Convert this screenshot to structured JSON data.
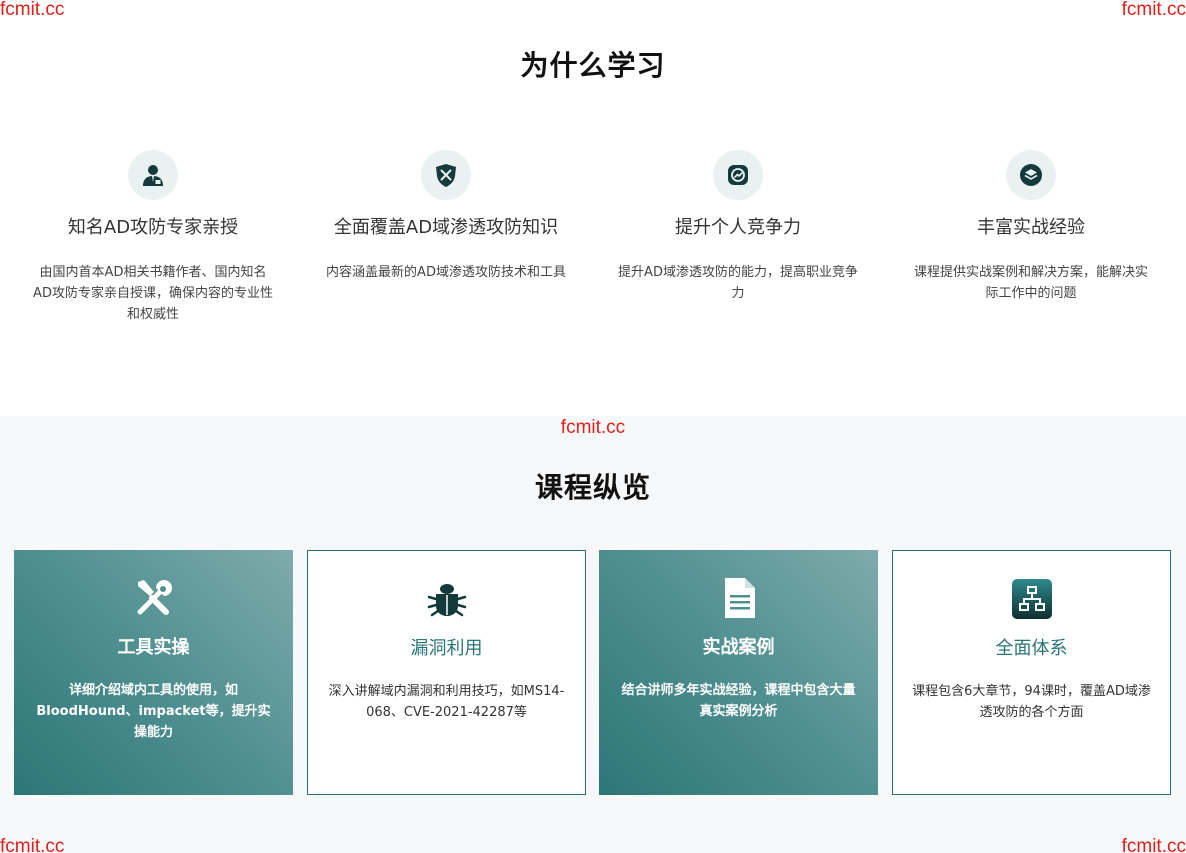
{
  "watermark": {
    "text": "fcmit.cc"
  },
  "why_section": {
    "title": "为什么学习",
    "features": [
      {
        "icon": "expert-icon",
        "title": "知名AD攻防专家亲授",
        "desc": "由国内首本AD相关书籍作者、国内知名AD攻防专家亲自授课，确保内容的专业性和权威性"
      },
      {
        "icon": "shield-sword-icon",
        "title": "全面覆盖AD域渗透攻防知识",
        "desc": "内容涵盖最新的AD域渗透攻防技术和工具"
      },
      {
        "icon": "growth-icon",
        "title": "提升个人竞争力",
        "desc": "提升AD域渗透攻防的能力，提高职业竞争力"
      },
      {
        "icon": "layers-icon",
        "title": "丰富实战经验",
        "desc": "课程提供实战案例和解决方案，能解决实际工作中的问题"
      }
    ]
  },
  "overview_section": {
    "title": "课程纵览",
    "cards": [
      {
        "icon": "tools-icon",
        "style": "dark",
        "title": "工具实操",
        "desc": "详细介绍域内工具的使用，如BloodHound、impacket等，提升实操能力"
      },
      {
        "icon": "bug-icon",
        "style": "light",
        "title": "漏洞利用",
        "desc": "深入讲解域内漏洞和利用技巧，如MS14-068、CVE-2021-42287等"
      },
      {
        "icon": "document-icon",
        "style": "dark",
        "title": "实战案例",
        "desc": "结合讲师多年实战经验，课程中包含大量真实案例分析"
      },
      {
        "icon": "sitemap-icon",
        "style": "light",
        "title": "全面体系",
        "desc": "课程包含6大章节，94课时，覆盖AD域渗透攻防的各个方面"
      }
    ]
  },
  "colors": {
    "accent": "#2a7577",
    "watermark": "#e0201b",
    "section_bg": "#f7f8fa",
    "icon_circle": "#e9f1f1"
  }
}
